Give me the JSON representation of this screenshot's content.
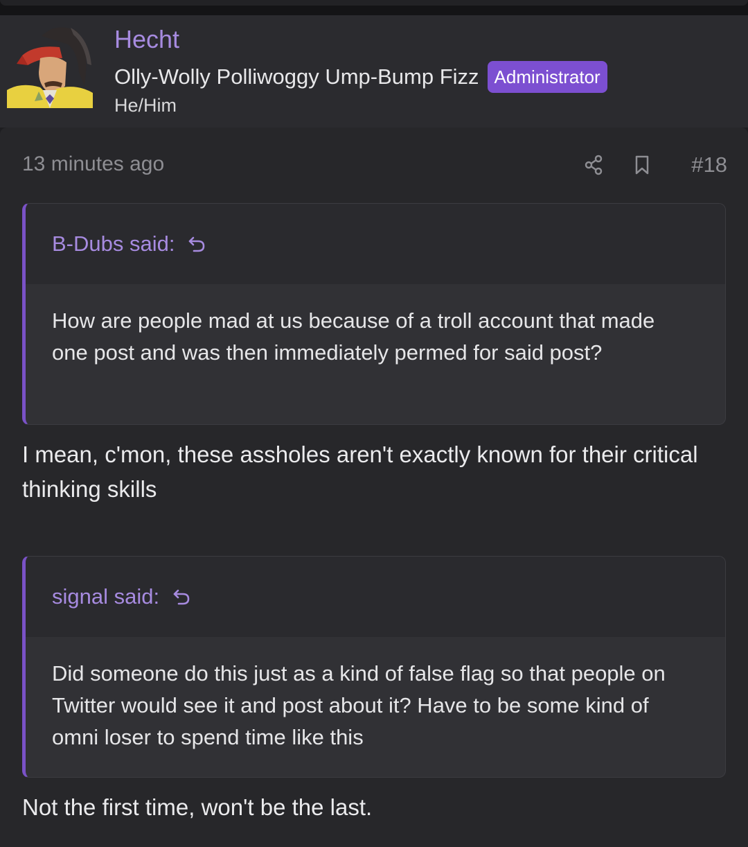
{
  "user": {
    "name": "Hecht",
    "title": "Olly-Wolly Polliwoggy Ump-Bump Fizz",
    "role_badge": "Administrator",
    "pronouns": "He/Him",
    "avatar_icon": "character-portrait-avatar"
  },
  "post": {
    "time": "13 minutes ago",
    "number": "#18",
    "share_icon": "share-icon",
    "bookmark_icon": "bookmark-icon",
    "quotes": [
      {
        "author_line": "B-Dubs said:",
        "text": "How are people mad at us because of a troll account that made one post and was then immediately permed for said post?"
      },
      {
        "author_line": "signal said:",
        "text": "Did someone do this just as a kind of false flag so that people on Twitter would see it and post about it? Have to be some kind of omni loser to spend time like this"
      }
    ],
    "replies": [
      "I mean, c'mon, these assholes aren't exactly known for their critical thinking skills",
      "Not the first time, won't be the last."
    ]
  },
  "colors": {
    "accent": "#a78be0",
    "badge": "#7c4fd1",
    "quote_border": "#7a52c7",
    "background": "#27272a"
  }
}
